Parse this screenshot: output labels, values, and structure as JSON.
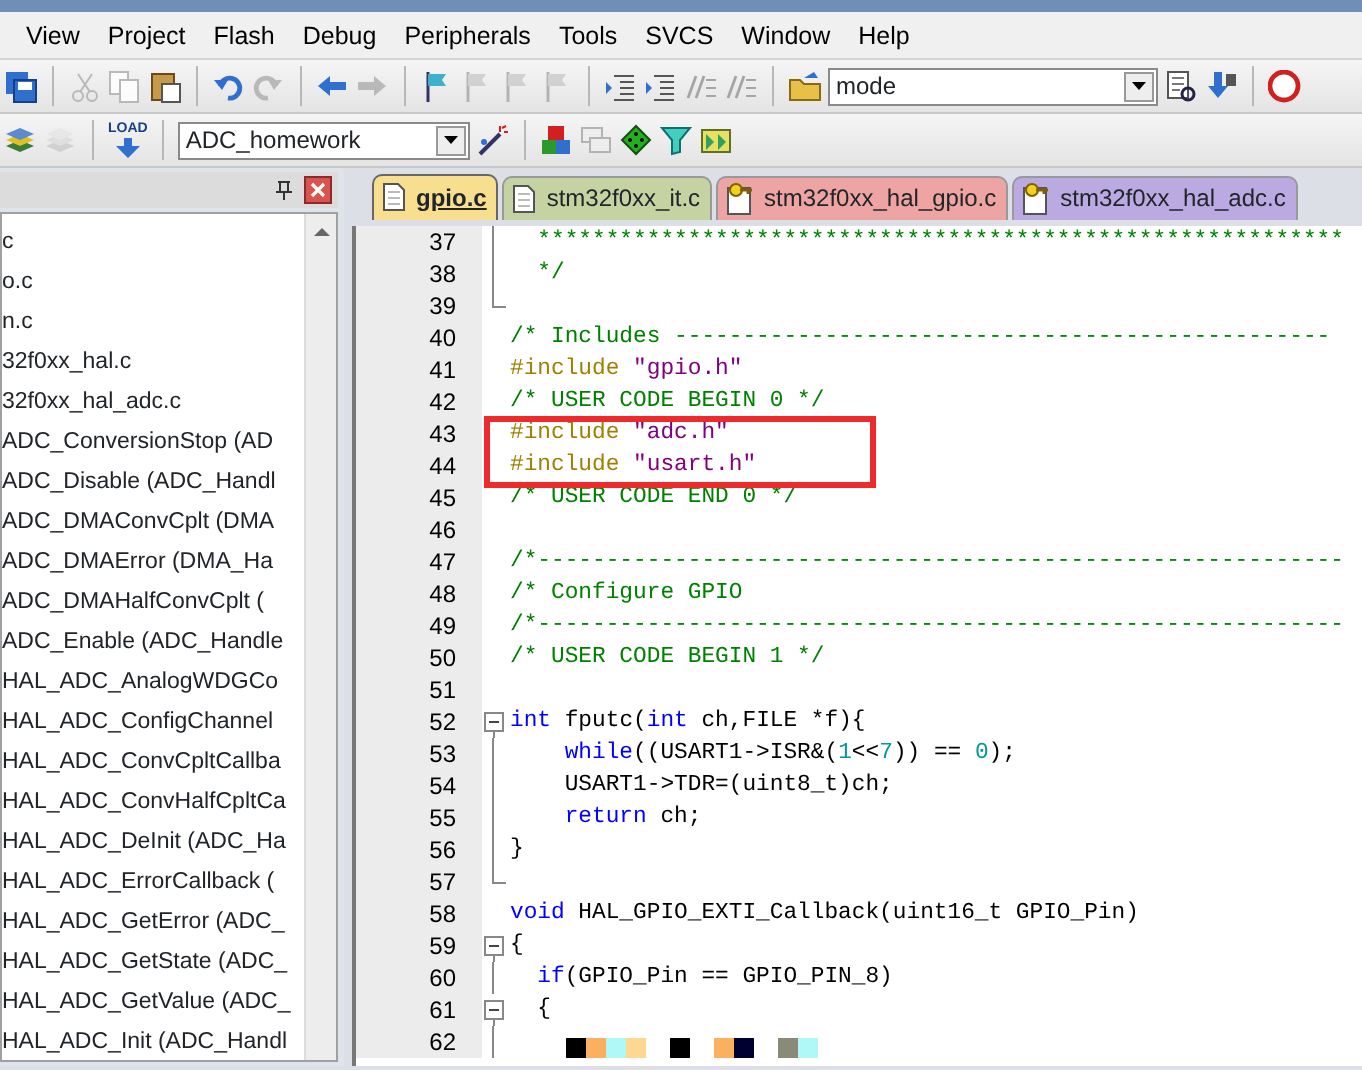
{
  "menu": [
    "View",
    "Project",
    "Flash",
    "Debug",
    "Peripherals",
    "Tools",
    "SVCS",
    "Window",
    "Help"
  ],
  "toolbar_1": [
    {
      "kind": "saveall",
      "disabled": false
    },
    {
      "kind": "sep"
    },
    {
      "kind": "cut",
      "disabled": true
    },
    {
      "kind": "copy",
      "disabled": true
    },
    {
      "kind": "paste",
      "disabled": false
    },
    {
      "kind": "sep"
    },
    {
      "kind": "undo",
      "disabled": false
    },
    {
      "kind": "redo",
      "disabled": true
    },
    {
      "kind": "sep"
    },
    {
      "kind": "back",
      "disabled": false
    },
    {
      "kind": "forward",
      "disabled": true
    },
    {
      "kind": "sep"
    },
    {
      "kind": "flag",
      "disabled": false
    },
    {
      "kind": "flag",
      "disabled": true
    },
    {
      "kind": "flag",
      "disabled": true
    },
    {
      "kind": "flag",
      "disabled": true
    },
    {
      "kind": "sep"
    },
    {
      "kind": "indent",
      "disabled": false
    },
    {
      "kind": "indent",
      "disabled": false
    },
    {
      "kind": "comment",
      "disabled": true
    },
    {
      "kind": "comment",
      "disabled": true
    },
    {
      "kind": "sep"
    },
    {
      "kind": "folder",
      "disabled": false
    },
    {
      "kind": "dropdown",
      "value": "mode"
    },
    {
      "kind": "find",
      "disabled": false
    },
    {
      "kind": "download",
      "disabled": false
    },
    {
      "kind": "sep"
    },
    {
      "kind": "debug",
      "disabled": false
    }
  ],
  "toolbar_2": [
    {
      "kind": "build",
      "disabled": false
    },
    {
      "kind": "build",
      "disabled": true
    },
    {
      "kind": "sep"
    },
    {
      "kind": "load",
      "disabled": false,
      "label": "LOAD"
    },
    {
      "kind": "sep"
    },
    {
      "kind": "dropdown",
      "value": "ADC_homework"
    },
    {
      "kind": "wand",
      "disabled": false
    },
    {
      "kind": "sep"
    },
    {
      "kind": "blocks",
      "disabled": false
    },
    {
      "kind": "windows",
      "disabled": true
    },
    {
      "kind": "diamond",
      "disabled": false
    },
    {
      "kind": "funnel",
      "disabled": false
    },
    {
      "kind": "pack",
      "disabled": false
    }
  ],
  "functions_panel": {
    "items": [
      "c",
      "o.c",
      "n.c",
      "32f0xx_hal.c",
      "32f0xx_hal_adc.c",
      "ADC_ConversionStop (AD",
      "ADC_Disable (ADC_Handl",
      "ADC_DMAConvCplt (DMA",
      "ADC_DMAError (DMA_Ha",
      "ADC_DMAHalfConvCplt (",
      "ADC_Enable (ADC_Handle",
      "HAL_ADC_AnalogWDGCo",
      "HAL_ADC_ConfigChannel",
      "HAL_ADC_ConvCpltCallba",
      "HAL_ADC_ConvHalfCpltCa",
      "HAL_ADC_DeInit (ADC_Ha",
      "HAL_ADC_ErrorCallback (",
      "HAL_ADC_GetError (ADC_",
      "HAL_ADC_GetState (ADC_",
      "HAL_ADC_GetValue (ADC_",
      "HAL_ADC_Init (ADC_Handl"
    ]
  },
  "tabs": [
    {
      "label": "gpio.c",
      "selected": true,
      "readonly": false,
      "color": "#f7df8f"
    },
    {
      "label": "stm32f0xx_it.c",
      "selected": false,
      "readonly": false,
      "color": "#c5d3a2"
    },
    {
      "label": "stm32f0xx_hal_gpio.c",
      "selected": false,
      "readonly": true,
      "color": "#eea4a2"
    },
    {
      "label": "stm32f0xx_hal_adc.c",
      "selected": false,
      "readonly": true,
      "color": "#bba9e2"
    }
  ],
  "code": [
    {
      "number": "37",
      "fold_guide": true,
      "parts": [
        {
          "kind": "comment",
          "t": "  ***********************************************************"
        }
      ]
    },
    {
      "number": "38",
      "fold_guide": true,
      "parts": [
        {
          "kind": "comment",
          "t": "  */"
        }
      ]
    },
    {
      "number": "39",
      "fold_end": true
    },
    {
      "number": "40",
      "parts": [
        {
          "kind": "comment",
          "t": "/* Includes ------------------------------------------------"
        }
      ]
    },
    {
      "number": "41",
      "parts": [
        {
          "kind": "preproc",
          "t": "#include "
        },
        {
          "kind": "string",
          "t": "\"gpio.h\""
        }
      ]
    },
    {
      "number": "42",
      "parts": [
        {
          "kind": "comment",
          "t": "/* USER CODE BEGIN 0 */"
        }
      ]
    },
    {
      "number": "43",
      "parts": [
        {
          "kind": "preproc",
          "t": "#include "
        },
        {
          "kind": "string",
          "t": "\"adc.h\""
        }
      ]
    },
    {
      "number": "44",
      "parts": [
        {
          "kind": "preproc",
          "t": "#include "
        },
        {
          "kind": "string",
          "t": "\"usart.h\""
        }
      ]
    },
    {
      "number": "45",
      "parts": [
        {
          "kind": "comment",
          "t": "/* USER CODE END 0 */"
        }
      ]
    },
    {
      "number": "46"
    },
    {
      "number": "47",
      "parts": [
        {
          "kind": "comment",
          "t": "/*-----------------------------------------------------------"
        }
      ]
    },
    {
      "number": "48",
      "parts": [
        {
          "kind": "comment",
          "t": "/* Configure GPIO"
        }
      ]
    },
    {
      "number": "49",
      "parts": [
        {
          "kind": "comment",
          "t": "/*-----------------------------------------------------------"
        }
      ]
    },
    {
      "number": "50",
      "parts": [
        {
          "kind": "comment",
          "t": "/* USER CODE BEGIN 1 */"
        }
      ]
    },
    {
      "number": "51"
    },
    {
      "number": "52",
      "fold_toggle": true,
      "parts": [
        {
          "kind": "keyword",
          "t": "int"
        },
        {
          "kind": "plain",
          "t": " fputc("
        },
        {
          "kind": "keyword",
          "t": "int"
        },
        {
          "kind": "plain",
          "t": " ch,FILE *f){"
        }
      ]
    },
    {
      "number": "53",
      "fold_guide": true,
      "parts": [
        {
          "kind": "keyword",
          "t": "    while"
        },
        {
          "kind": "plain",
          "t": "((USART1->ISR&("
        },
        {
          "kind": "number",
          "t": "1"
        },
        {
          "kind": "plain",
          "t": "<<"
        },
        {
          "kind": "number",
          "t": "7"
        },
        {
          "kind": "plain",
          "t": ")) == "
        },
        {
          "kind": "number",
          "t": "0"
        },
        {
          "kind": "plain",
          "t": ");"
        }
      ]
    },
    {
      "number": "54",
      "fold_guide": true,
      "parts": [
        {
          "kind": "plain",
          "t": "    USART1->TDR=(uint8_t)ch;"
        }
      ]
    },
    {
      "number": "55",
      "fold_guide": true,
      "parts": [
        {
          "kind": "keyword",
          "t": "    return"
        },
        {
          "kind": "plain",
          "t": " ch;"
        }
      ]
    },
    {
      "number": "56",
      "fold_guide": true,
      "parts": [
        {
          "kind": "plain",
          "t": "}"
        }
      ]
    },
    {
      "number": "57",
      "fold_end": true
    },
    {
      "number": "58",
      "parts": [
        {
          "kind": "keyword",
          "t": "void"
        },
        {
          "kind": "plain",
          "t": " HAL_GPIO_EXTI_Callback(uint16_t GPIO_Pin)"
        }
      ]
    },
    {
      "number": "59",
      "fold_toggle": true,
      "parts": [
        {
          "kind": "plain",
          "t": "{"
        }
      ]
    },
    {
      "number": "60",
      "fold_guide": true,
      "parts": [
        {
          "kind": "keyword",
          "t": "  if"
        },
        {
          "kind": "plain",
          "t": "(GPIO_Pin == GPIO_PIN_8)"
        }
      ]
    },
    {
      "number": "61",
      "fold_toggle": true,
      "parts": [
        {
          "kind": "plain",
          "t": "  {"
        }
      ]
    },
    {
      "number": "62",
      "fold_guide": true,
      "redacted": true
    }
  ]
}
